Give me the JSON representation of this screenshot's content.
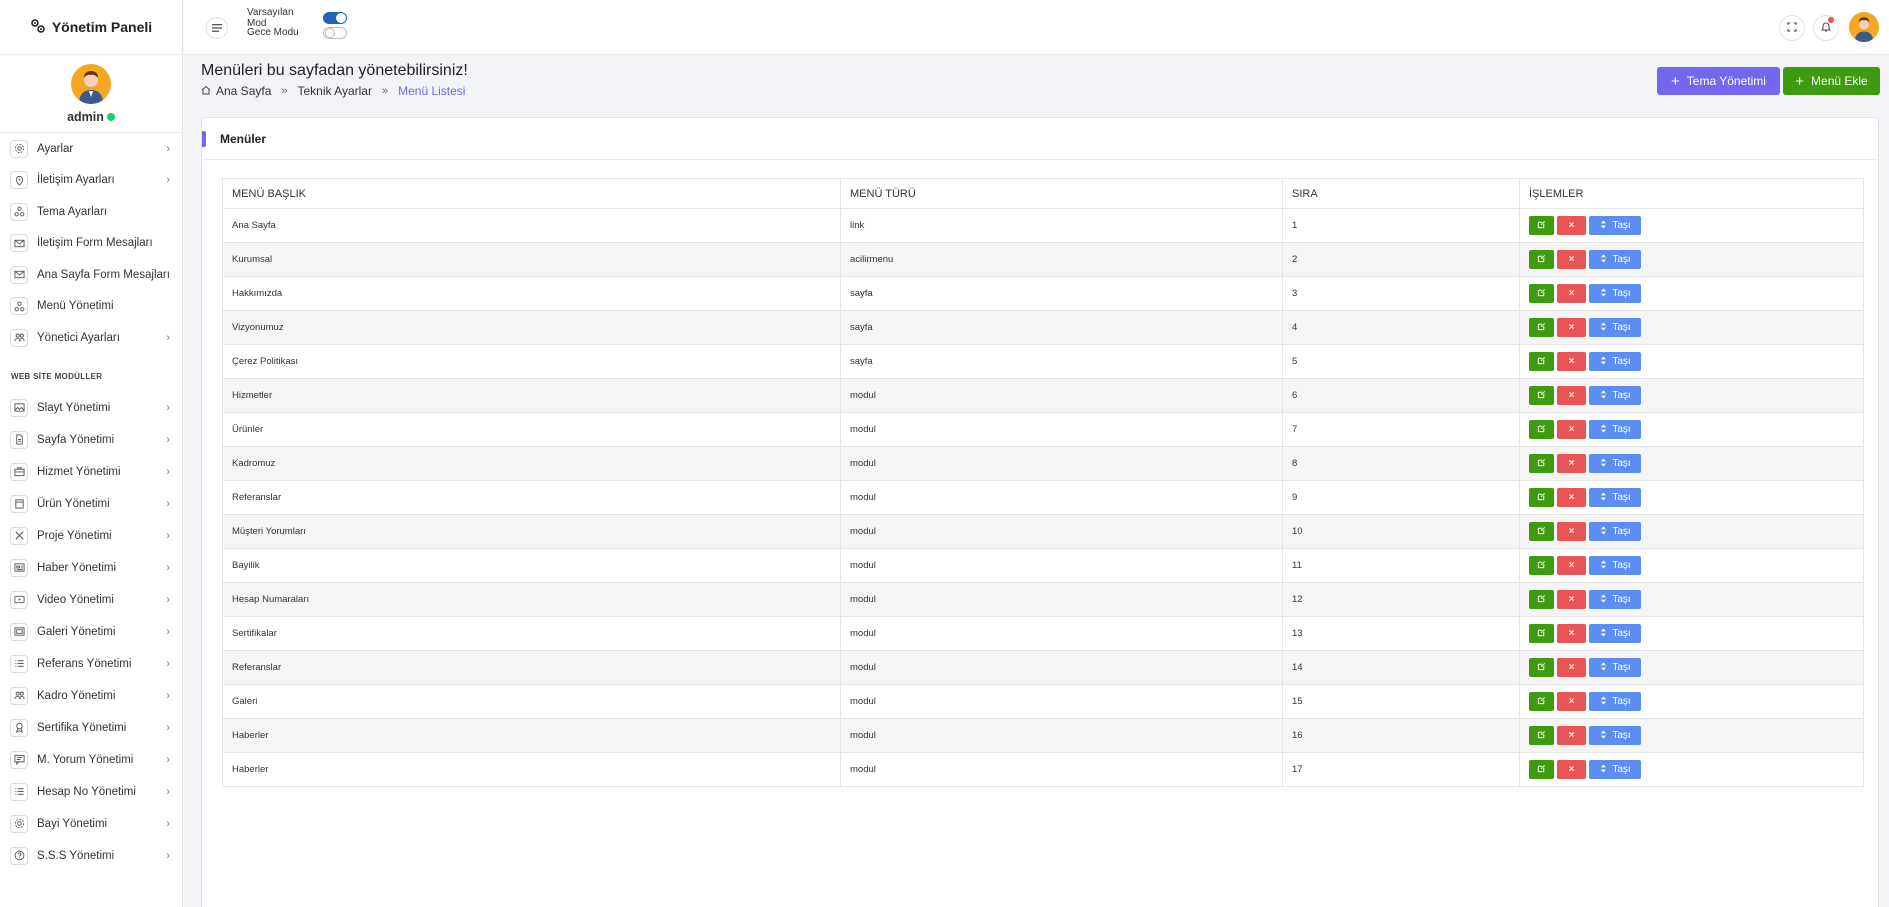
{
  "brand": {
    "title": "Yönetim Paneli",
    "icon": "cogs-icon"
  },
  "user": {
    "name": "admin",
    "status": "online"
  },
  "sidebar": {
    "items": [
      {
        "label": "Ayarlar",
        "icon": "gear-icon",
        "has_children": true
      },
      {
        "label": "İletişim Ayarları",
        "icon": "map-pin-icon",
        "has_children": true
      },
      {
        "label": "Tema Ayarları",
        "icon": "nodes-icon",
        "has_children": false
      },
      {
        "label": "İletişim Form Mesajları",
        "icon": "mail-icon",
        "has_children": false
      },
      {
        "label": "Ana Sayfa Form Mesajları",
        "icon": "mail-icon",
        "has_children": false
      },
      {
        "label": "Menü Yönetimi",
        "icon": "nodes-icon",
        "has_children": false
      },
      {
        "label": "Yönetici Ayarları",
        "icon": "users-icon",
        "has_children": true
      }
    ],
    "section_title": "WEB SİTE MODÜLLER",
    "modules": [
      {
        "label": "Slayt Yönetimi",
        "icon": "image-icon"
      },
      {
        "label": "Sayfa Yönetimi",
        "icon": "file-icon"
      },
      {
        "label": "Hizmet Yönetimi",
        "icon": "briefcase-icon"
      },
      {
        "label": "Ürün Yönetimi",
        "icon": "box-icon"
      },
      {
        "label": "Proje Yönetimi",
        "icon": "tools-icon"
      },
      {
        "label": "Haber Yönetimi",
        "icon": "news-icon"
      },
      {
        "label": "Video Yönetimi",
        "icon": "video-icon"
      },
      {
        "label": "Galeri Yönetimi",
        "icon": "gallery-icon"
      },
      {
        "label": "Referans Yönetimi",
        "icon": "list-icon"
      },
      {
        "label": "Kadro Yönetimi",
        "icon": "users-icon"
      },
      {
        "label": "Sertifika Yönetimi",
        "icon": "award-icon"
      },
      {
        "label": "M. Yorum Yönetimi",
        "icon": "comment-icon"
      },
      {
        "label": "Hesap No Yönetimi",
        "icon": "list-icon"
      },
      {
        "label": "Bayi Yönetimi",
        "icon": "gear-icon"
      },
      {
        "label": "S.S.S Yönetimi",
        "icon": "help-icon"
      }
    ],
    "chevron": "›"
  },
  "topbar": {
    "default_mode_label": "Varsayılan Mod",
    "night_mode_label": "Gece Modu",
    "default_mode_on": true,
    "night_mode_on": false
  },
  "page": {
    "title": "Menüleri bu sayfadan yönetebilirsiniz!",
    "breadcrumb": [
      "Ana Sayfa",
      "Teknik Ayarlar",
      "Menü Listesi"
    ],
    "breadcrumb_sep": "»",
    "buttons": {
      "theme": "Tema Yönetimi",
      "add_menu": "Menü Ekle"
    }
  },
  "card": {
    "title": "Menüler",
    "columns": [
      "MENÜ BAŞLIK",
      "MENÜ TÜRÜ",
      "SIRA",
      "İŞLEMLER"
    ],
    "move_label": "Taşı",
    "delete_label": "×",
    "rows": [
      {
        "title": "Ana Sayfa",
        "type": "link",
        "order": "1"
      },
      {
        "title": "Kurumsal",
        "type": "acilirmenu",
        "order": "2"
      },
      {
        "title": "Hakkımızda",
        "type": "sayfa",
        "order": "3"
      },
      {
        "title": "Vizyonumuz",
        "type": "sayfa",
        "order": "4"
      },
      {
        "title": "Çerez Politikası",
        "type": "sayfa",
        "order": "5"
      },
      {
        "title": "Hizmetler",
        "type": "modul",
        "order": "6"
      },
      {
        "title": "Ürünler",
        "type": "modul",
        "order": "7"
      },
      {
        "title": "Kadromuz",
        "type": "modul",
        "order": "8"
      },
      {
        "title": "Referanslar",
        "type": "modul",
        "order": "9"
      },
      {
        "title": "Müşteri Yorumları",
        "type": "modul",
        "order": "10"
      },
      {
        "title": "Bayilik",
        "type": "modul",
        "order": "11"
      },
      {
        "title": "Hesap Numaraları",
        "type": "modul",
        "order": "12"
      },
      {
        "title": "Sertifikalar",
        "type": "modul",
        "order": "13"
      },
      {
        "title": "Referanslar",
        "type": "modul",
        "order": "14"
      },
      {
        "title": "Galeri",
        "type": "modul",
        "order": "15"
      },
      {
        "title": "Haberler",
        "type": "modul",
        "order": "16"
      },
      {
        "title": "Haberler",
        "type": "modul",
        "order": "17"
      }
    ]
  },
  "colors": {
    "accent": "#7367f0",
    "success": "#3e9a0e",
    "danger": "#ea5455",
    "info": "#5b8ef0",
    "avatar": "#f5a623"
  }
}
